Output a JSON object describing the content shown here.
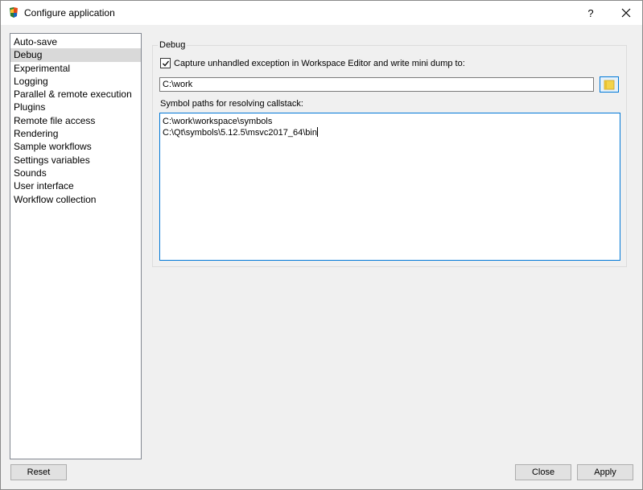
{
  "window": {
    "title": "Configure application",
    "help_label": "?"
  },
  "sidebar": {
    "items": [
      {
        "label": "Auto-save"
      },
      {
        "label": "Debug"
      },
      {
        "label": "Experimental"
      },
      {
        "label": "Logging"
      },
      {
        "label": "Parallel & remote execution"
      },
      {
        "label": "Plugins"
      },
      {
        "label": "Remote file access"
      },
      {
        "label": "Rendering"
      },
      {
        "label": "Sample workflows"
      },
      {
        "label": "Settings variables"
      },
      {
        "label": "Sounds"
      },
      {
        "label": "User interface"
      },
      {
        "label": "Workflow collection"
      }
    ],
    "selected": "Debug"
  },
  "debug": {
    "group_title": "Debug",
    "checkbox_checked": true,
    "checkbox_label": "Capture unhandled exception in Workspace Editor and write mini dump to:",
    "dump_path": "C:\\work",
    "symbols_label": "Symbol paths for resolving callstack:",
    "symbol_lines": [
      "C:\\work\\workspace\\symbols",
      "C:\\Qt\\symbols\\5.12.5\\msvc2017_64\\bin"
    ]
  },
  "buttons": {
    "reset": "Reset",
    "close": "Close",
    "apply": "Apply"
  },
  "colors": {
    "accent": "#0078d7",
    "selection": "#d9d9d9",
    "dialog_bg": "#f0f0f0"
  }
}
